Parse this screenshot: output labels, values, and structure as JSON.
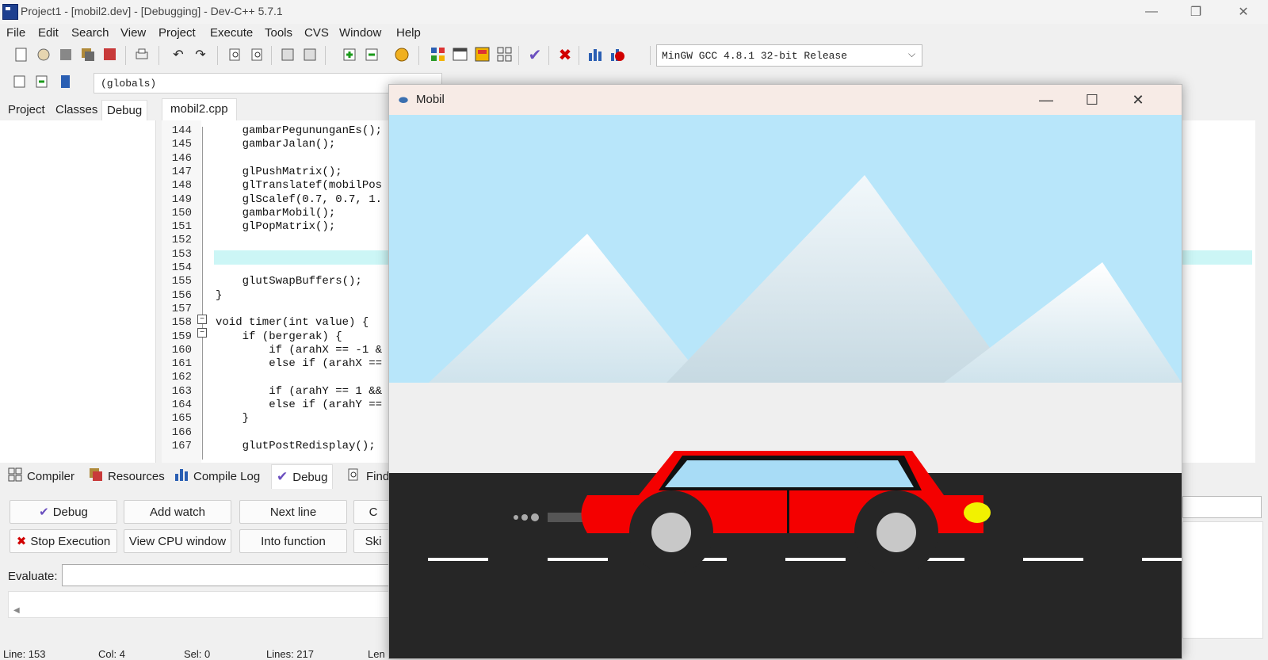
{
  "window": {
    "title": "Project1 - [mobil2.dev] - [Debugging] - Dev-C++ 5.7.1",
    "minimize": "—",
    "restore": "❐",
    "close": "✕"
  },
  "menu": [
    "File",
    "Edit",
    "Search",
    "View",
    "Project",
    "Execute",
    "Tools",
    "CVS",
    "Window",
    "Help"
  ],
  "toolbar": {
    "compiler": "MinGW GCC 4.8.1 32-bit Release",
    "scope": "(globals)"
  },
  "left_tabs": [
    "Project",
    "Classes",
    "Debug"
  ],
  "editor": {
    "file_tab": "mobil2.cpp",
    "lines": [
      {
        "n": "144",
        "code": "    gambarPegununganEs();"
      },
      {
        "n": "145",
        "code": "    gambarJalan();"
      },
      {
        "n": "146",
        "code": ""
      },
      {
        "n": "147",
        "code": "    glPushMatrix();"
      },
      {
        "n": "148",
        "code": "    glTranslatef(mobilPos"
      },
      {
        "n": "149",
        "code": "    glScalef(0.7, 0.7, 1."
      },
      {
        "n": "150",
        "code": "    gambarMobil();"
      },
      {
        "n": "151",
        "code": "    glPopMatrix();"
      },
      {
        "n": "152",
        "code": ""
      },
      {
        "n": "153",
        "code": ""
      },
      {
        "n": "154",
        "code": ""
      },
      {
        "n": "155",
        "code": "    glutSwapBuffers();"
      },
      {
        "n": "156",
        "code": "}"
      },
      {
        "n": "157",
        "code": ""
      },
      {
        "n": "158",
        "code": "void timer(int value) {"
      },
      {
        "n": "159",
        "code": "    if (bergerak) {"
      },
      {
        "n": "160",
        "code": "        if (arahX == -1 &"
      },
      {
        "n": "161",
        "code": "        else if (arahX =="
      },
      {
        "n": "162",
        "code": ""
      },
      {
        "n": "163",
        "code": "        if (arahY == 1 &&"
      },
      {
        "n": "164",
        "code": "        else if (arahY =="
      },
      {
        "n": "165",
        "code": "    }"
      },
      {
        "n": "166",
        "code": ""
      },
      {
        "n": "167",
        "code": "    glutPostRedisplay();"
      }
    ]
  },
  "bottom_tabs": [
    "Compiler",
    "Resources",
    "Compile Log",
    "Debug",
    "Find"
  ],
  "debug_buttons": {
    "debug": "Debug",
    "add_watch": "Add watch",
    "next_line": "Next line",
    "continue_partial": "C",
    "stop": "Stop Execution",
    "view_cpu": "View CPU window",
    "into_function": "Into function",
    "skip_partial": "Ski"
  },
  "evaluate_label": "Evaluate:",
  "status": {
    "line": "Line: 153",
    "col": "Col: 4",
    "sel": "Sel: 0",
    "lines": "Lines: 217",
    "len": "Len"
  },
  "mobil_window": {
    "title": "Mobil",
    "minimize": "—",
    "maximize": "☐",
    "close": "✕"
  },
  "colors": {
    "sky": "#b8e6fa",
    "road": "#262626",
    "car_body": "#f40000",
    "car_window": "#a8dcf6",
    "headlight": "#f2f200",
    "wheel": "#262626",
    "hubcap": "#c8c8c8"
  }
}
